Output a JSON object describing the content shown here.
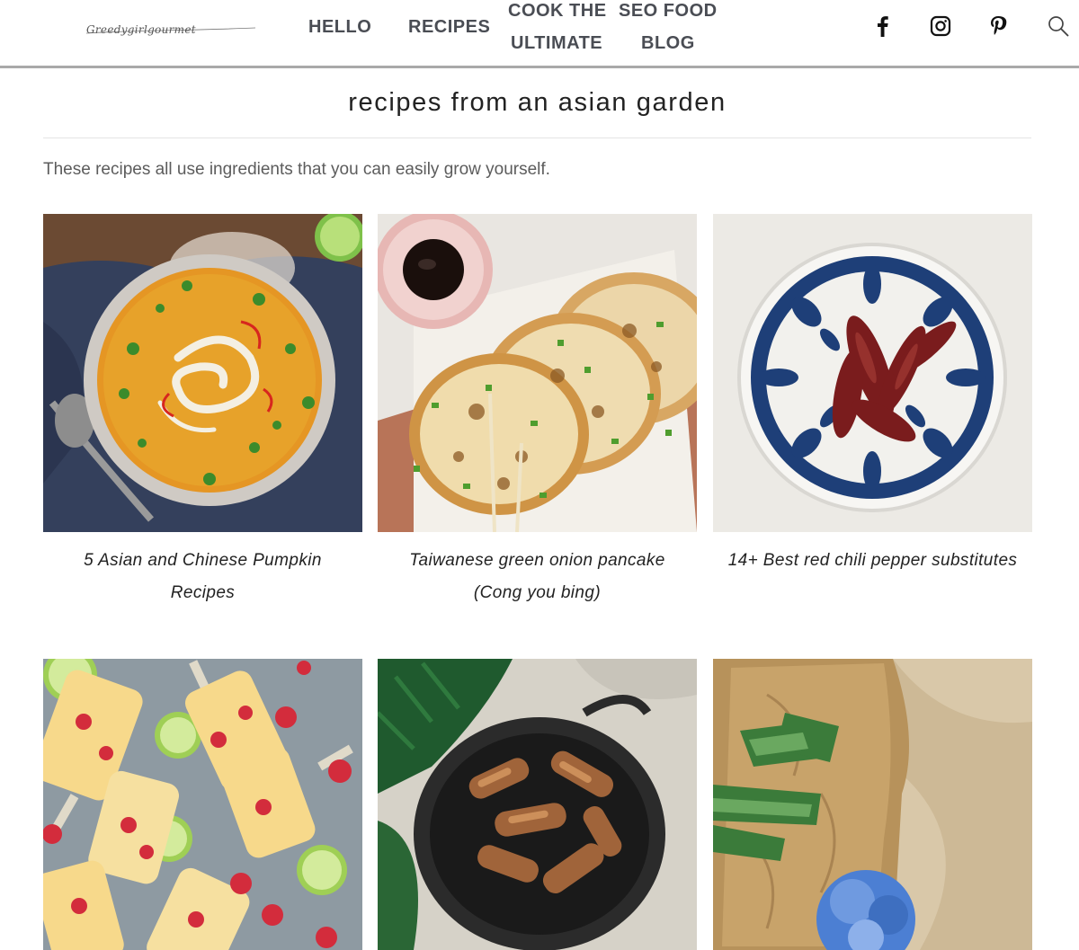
{
  "site": {
    "logo_text": "Greedygirlgourmet"
  },
  "nav": {
    "hello": "HELLO",
    "recipes": "RECIPES",
    "cook_line1": "COOK THE",
    "cook_line2": "ULTIMATE",
    "seo_line1": "SEO FOOD",
    "seo_line2": "BLOG"
  },
  "social": {
    "facebook": "facebook-icon",
    "instagram": "instagram-icon",
    "pinterest": "pinterest-icon",
    "search": "search-icon"
  },
  "page": {
    "title": "recipes from an asian garden",
    "intro": "These recipes all use ingredients that you can easily grow yourself."
  },
  "cards": [
    {
      "title_line1": "5 Asian and Chinese Pumpkin",
      "title_line2": "Recipes",
      "image": "pumpkin-soup-image"
    },
    {
      "title_line1": "Taiwanese green onion pancake",
      "title_line2": "(Cong you bing)",
      "image": "green-onion-pancake-image"
    },
    {
      "title_line1": "14+ Best red chili pepper substitutes",
      "title_line2": "",
      "image": "dried-chili-bowl-image"
    },
    {
      "title_line1": "",
      "title_line2": "",
      "image": "lime-raspberry-popsicles-image"
    },
    {
      "title_line1": "",
      "title_line2": "",
      "image": "mushroom-pan-image"
    },
    {
      "title_line1": "",
      "title_line2": "",
      "image": "aloe-vera-image"
    }
  ],
  "colors": {
    "nav_text": "#4a4d54",
    "header_border": "#a9a9a9",
    "title_text": "#222222",
    "intro_text": "#5c5c5c"
  }
}
